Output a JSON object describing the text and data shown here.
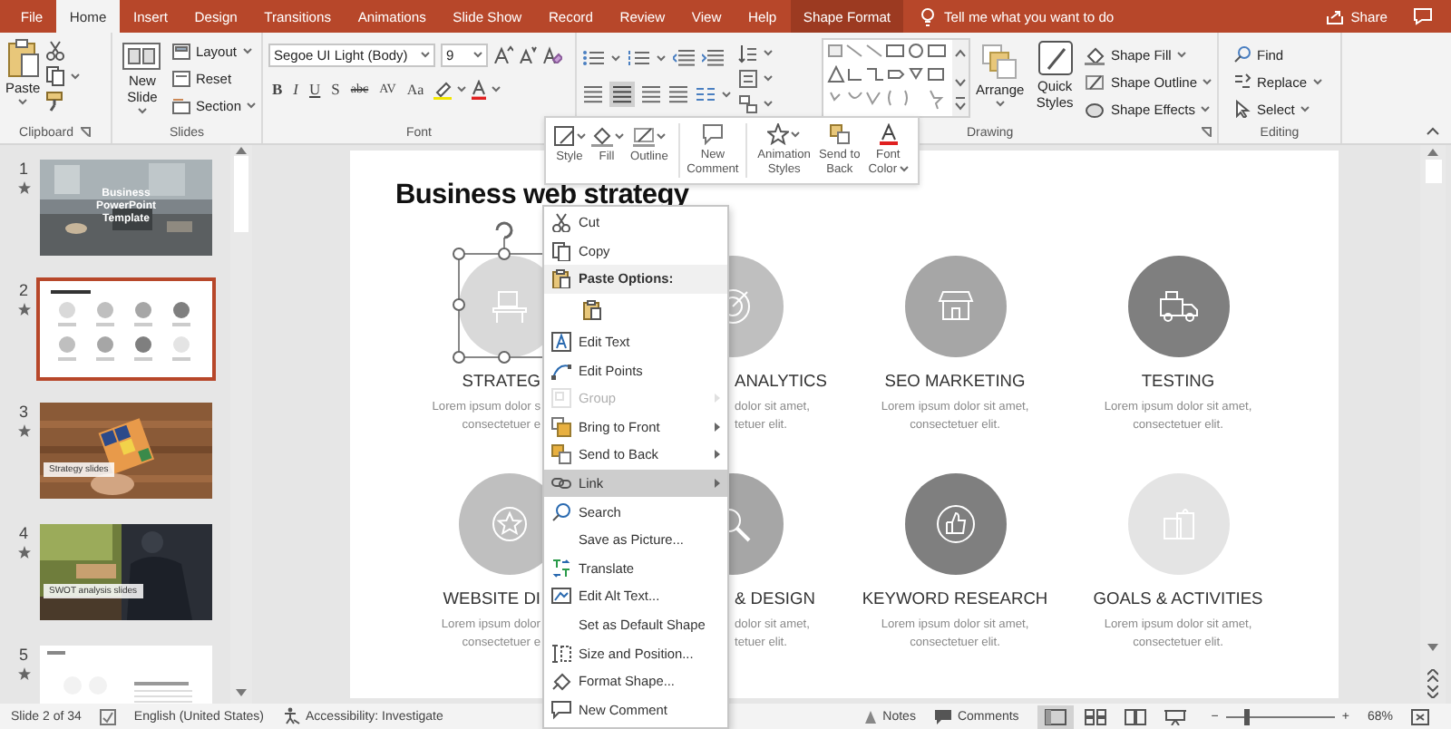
{
  "tabs": [
    {
      "label": "File",
      "selected": false,
      "kind": "tab"
    },
    {
      "label": "Home",
      "selected": true,
      "kind": "tab"
    },
    {
      "label": "Insert",
      "selected": false,
      "kind": "tab"
    },
    {
      "label": "Design",
      "selected": false,
      "kind": "tab"
    },
    {
      "label": "Transitions",
      "selected": false,
      "kind": "tab"
    },
    {
      "label": "Animations",
      "selected": false,
      "kind": "tab"
    },
    {
      "label": "Slide Show",
      "selected": false,
      "kind": "tab"
    },
    {
      "label": "Record",
      "selected": false,
      "kind": "tab"
    },
    {
      "label": "Review",
      "selected": false,
      "kind": "tab"
    },
    {
      "label": "View",
      "selected": false,
      "kind": "tab"
    },
    {
      "label": "Help",
      "selected": false,
      "kind": "tab"
    },
    {
      "label": "Shape Format",
      "selected": false,
      "kind": "contextual"
    }
  ],
  "tell_me": "Tell me what you want to do",
  "share": "Share",
  "ribbon": {
    "clipboard": {
      "paste": "Paste",
      "label": "Clipboard"
    },
    "slides": {
      "new_slide": "New Slide",
      "layout": "Layout",
      "reset": "Reset",
      "section": "Section",
      "label": "Slides"
    },
    "font": {
      "face": "Segoe UI Light (Body)",
      "size": "9",
      "buttons": [
        "B",
        "I",
        "U",
        "S",
        "abc",
        "AV",
        "Aa"
      ],
      "label": "Font"
    },
    "drawing": {
      "arrange": "Arrange",
      "quick_styles": "Quick Styles",
      "shape_fill": "Shape Fill",
      "shape_outline": "Shape Outline",
      "shape_effects": "Shape Effects",
      "label": "Drawing"
    },
    "editing": {
      "find": "Find",
      "replace": "Replace",
      "select": "Select",
      "label": "Editing"
    }
  },
  "slides_panel": [
    {
      "number": "1",
      "kind": "cover",
      "title": "Business PowerPoint Template",
      "selected": false
    },
    {
      "number": "2",
      "kind": "grid",
      "selected": true
    },
    {
      "number": "3",
      "kind": "section",
      "title": "Strategy slides",
      "selected": false
    },
    {
      "number": "4",
      "kind": "section",
      "title": "SWOT analysis slides",
      "selected": false
    },
    {
      "number": "5",
      "kind": "document",
      "selected": false
    }
  ],
  "slide": {
    "title": "Business web strategy",
    "cards": [
      {
        "label": "STRATEG",
        "desc": [
          "Lorem ipsum dolor s",
          "consectetuer e"
        ],
        "color": "#d9d9d9"
      },
      {
        "label": "ANALYTICS",
        "desc": [
          "dolor sit amet,",
          "tetuer elit."
        ],
        "color": "#bfbfbf"
      },
      {
        "label": "SEO MARKETING",
        "desc": [
          "Lorem ipsum dolor sit amet,",
          "consectetuer elit."
        ],
        "color": "#a6a6a6"
      },
      {
        "label": "TESTING",
        "desc": [
          "Lorem ipsum dolor sit amet,",
          "consectetuer elit."
        ],
        "color": "#7f7f7f"
      },
      {
        "label": "WEBSITE DI",
        "desc": [
          "Lorem ipsum dolor",
          "consectetuer e"
        ],
        "color": "#bfbfbf"
      },
      {
        "label": "& DESIGN",
        "desc": [
          "dolor sit amet,",
          "tetuer elit."
        ],
        "color": "#a6a6a6"
      },
      {
        "label": "KEYWORD RESEARCH",
        "desc": [
          "Lorem ipsum dolor sit amet,",
          "consectetuer elit."
        ],
        "color": "#7f7f7f"
      },
      {
        "label": "GOALS & ACTIVITIES",
        "desc": [
          "Lorem ipsum dolor sit amet,",
          "consectetuer elit."
        ],
        "color": "#e4e4e4"
      }
    ]
  },
  "mini_toolbar": [
    "Style",
    "Fill",
    "Outline",
    "New Comment",
    "Animation Styles",
    "Send to Back",
    "Font Color"
  ],
  "context_menu": [
    {
      "label": "Cut",
      "kind": "item",
      "disabled": false,
      "selected": false,
      "submenu": false
    },
    {
      "label": "Copy",
      "kind": "item",
      "disabled": false,
      "selected": false,
      "submenu": false
    },
    {
      "label": "Paste Options:",
      "kind": "header",
      "disabled": false,
      "selected": false,
      "submenu": false
    },
    {
      "kind": "paste",
      "disabled": false,
      "selected": false,
      "submenu": false
    },
    {
      "label": "Edit Text",
      "kind": "item",
      "disabled": false,
      "selected": false,
      "submenu": false
    },
    {
      "label": "Edit Points",
      "kind": "item",
      "disabled": false,
      "selected": false,
      "submenu": false
    },
    {
      "label": "Group",
      "kind": "item",
      "disabled": true,
      "selected": false,
      "submenu": true
    },
    {
      "label": "Bring to Front",
      "kind": "item",
      "disabled": false,
      "selected": false,
      "submenu": true
    },
    {
      "label": "Send to Back",
      "kind": "item",
      "disabled": false,
      "selected": false,
      "submenu": true
    },
    {
      "label": "Link",
      "kind": "item",
      "disabled": false,
      "selected": true,
      "submenu": true
    },
    {
      "label": "Search",
      "kind": "item",
      "disabled": false,
      "selected": false,
      "submenu": false
    },
    {
      "label": "Save as Picture...",
      "kind": "item",
      "disabled": false,
      "selected": false,
      "submenu": false
    },
    {
      "label": "Translate",
      "kind": "item",
      "disabled": false,
      "selected": false,
      "submenu": false
    },
    {
      "label": "Edit Alt Text...",
      "kind": "item",
      "disabled": false,
      "selected": false,
      "submenu": false
    },
    {
      "label": "Set as Default Shape",
      "kind": "item",
      "disabled": false,
      "selected": false,
      "submenu": false
    },
    {
      "label": "Size and Position...",
      "kind": "item",
      "disabled": false,
      "selected": false,
      "submenu": false
    },
    {
      "label": "Format Shape...",
      "kind": "item",
      "disabled": false,
      "selected": false,
      "submenu": false
    },
    {
      "label": "New Comment",
      "kind": "item",
      "disabled": false,
      "selected": false,
      "submenu": false
    }
  ],
  "status_bar": {
    "slide": "Slide 2 of 34",
    "language": "English (United States)",
    "accessibility": "Accessibility: Investigate",
    "notes": "Notes",
    "comments": "Comments",
    "views": [
      {
        "selected": true
      },
      {
        "selected": false
      },
      {
        "selected": false
      },
      {
        "selected": false
      }
    ],
    "zoom_out": "−",
    "zoom_in": "+",
    "zoom": {
      "level": 0.18,
      "reading": "68%"
    }
  }
}
